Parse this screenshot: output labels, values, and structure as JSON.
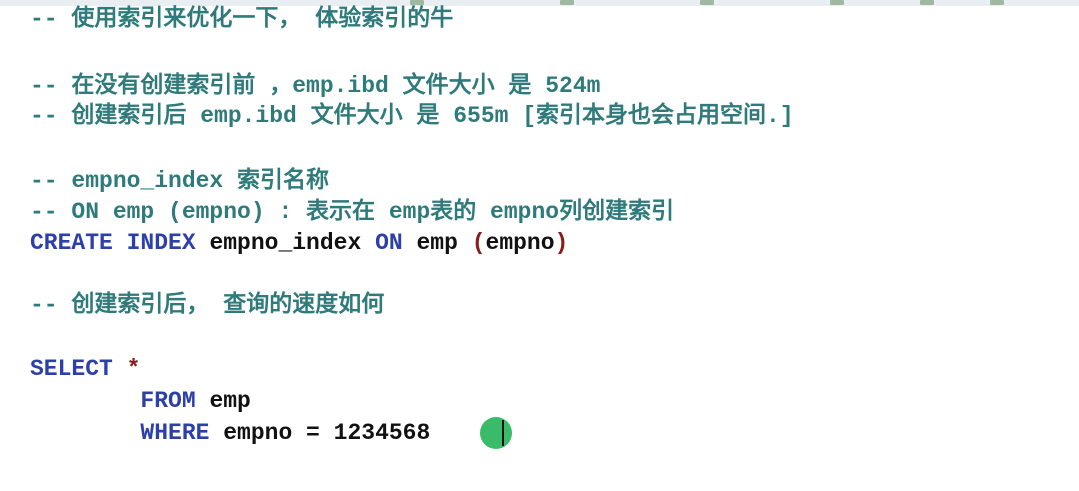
{
  "lines": [
    {
      "parts": [
        {
          "cls": "cm",
          "text": "-- 使用索引来优化一下， 体验索引的牛"
        }
      ]
    },
    {
      "parts": [
        {
          "cls": "cm",
          "text": "-- 在没有创建索引前 ，emp.ibd 文件大小 是 524m"
        }
      ]
    },
    {
      "parts": [
        {
          "cls": "cm",
          "text": "-- 创建索引后 emp.ibd 文件大小 是 655m [索引本身也会占用空间.]"
        }
      ]
    },
    {
      "parts": [
        {
          "cls": "cm",
          "text": "-- empno_index 索引名称"
        }
      ]
    },
    {
      "parts": [
        {
          "cls": "cm",
          "text": "-- ON emp (empno) : 表示在 emp表的 empno列创建索引"
        }
      ]
    },
    {
      "parts": [
        {
          "cls": "kw",
          "text": "CREATE INDEX"
        },
        {
          "cls": "plain",
          "text": " empno_index "
        },
        {
          "cls": "kw",
          "text": "ON"
        },
        {
          "cls": "plain",
          "text": " emp "
        },
        {
          "cls": "op",
          "text": "("
        },
        {
          "cls": "plain",
          "text": "empno"
        },
        {
          "cls": "op",
          "text": ")"
        }
      ]
    },
    {
      "parts": [
        {
          "cls": "cm",
          "text": "-- 创建索引后， 查询的速度如何"
        }
      ]
    },
    {
      "parts": [
        {
          "cls": "kw",
          "text": "SELECT"
        },
        {
          "cls": "plain",
          "text": " "
        },
        {
          "cls": "op",
          "text": "*"
        }
      ]
    },
    {
      "parts": [
        {
          "cls": "plain",
          "text": "        "
        },
        {
          "cls": "kw",
          "text": "FROM"
        },
        {
          "cls": "plain",
          "text": " emp"
        }
      ]
    },
    {
      "parts": [
        {
          "cls": "plain",
          "text": "        "
        },
        {
          "cls": "kw",
          "text": "WHERE"
        },
        {
          "cls": "plain",
          "text": " empno = 1234568"
        }
      ]
    }
  ]
}
